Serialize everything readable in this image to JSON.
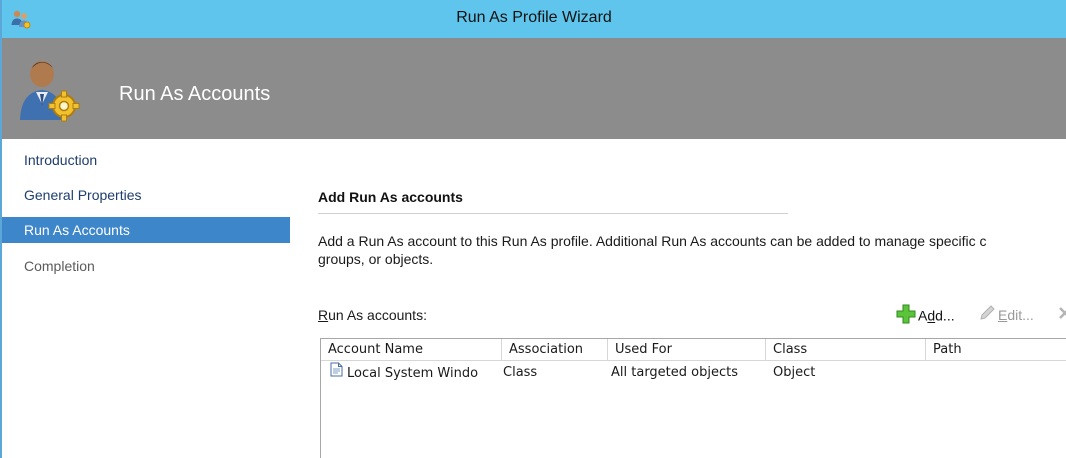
{
  "window": {
    "title": "Run As Profile Wizard",
    "app_icon": "run-as-profile-icon"
  },
  "banner": {
    "title": "Run As Accounts",
    "icon": "user-gear-icon"
  },
  "nav": {
    "items": [
      {
        "label": "Introduction",
        "state": "normal"
      },
      {
        "label": "General Properties",
        "state": "normal"
      },
      {
        "label": "Run As Accounts",
        "state": "selected"
      },
      {
        "label": "Completion",
        "state": "disabled"
      }
    ]
  },
  "content": {
    "section_title": "Add Run As accounts",
    "description_line1": "Add a Run As account to this Run As profile.  Additional Run As accounts can be added to manage specific c",
    "description_line2": "groups, or objects.",
    "list_label": "Run As accounts:",
    "list_label_mnemonic": "R",
    "list_label_rest": "un As accounts:",
    "toolbar": {
      "add_label_pre": "A",
      "add_label_mn": "d",
      "add_label_post": "d...",
      "edit_label_pre": "",
      "edit_label_mn": "E",
      "edit_label_post": "dit...",
      "add_icon": "green-plus-icon",
      "edit_icon": "pencil-icon",
      "remove_icon": "remove-x-icon"
    },
    "table": {
      "columns": [
        "Account Name",
        "Association",
        "Used For",
        "Class",
        "Path"
      ],
      "rows": [
        {
          "account_name": "Local System Windo",
          "association": "Class",
          "used_for": "All targeted objects",
          "class": "Object",
          "path": "",
          "icon": "document-icon"
        }
      ]
    }
  },
  "colors": {
    "titlebar": "#5fc5ec",
    "banner": "#8c8c8c",
    "nav_selected": "#3d86c9"
  }
}
